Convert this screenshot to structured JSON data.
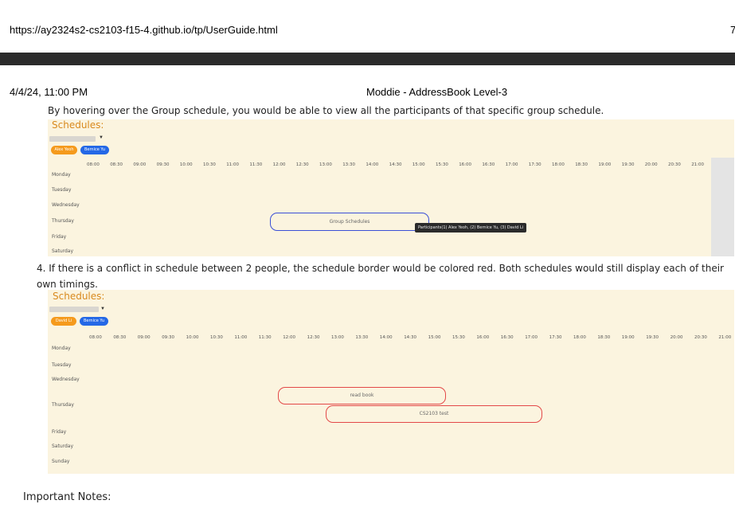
{
  "browser": {
    "url": "https://ay2324s2-cs2103-f15-4.github.io/tp/UserGuide.html",
    "edge_fragment": "7"
  },
  "print_header": {
    "datetime": "4/4/24, 11:00 PM",
    "doc_title": "Moddie - AddressBook Level-3"
  },
  "content": {
    "hover_paragraph": "By hovering over the Group schedule, you would be able to view all the participants of that specific group schedule.",
    "item4_text": "4. If there is a conflict in schedule between 2 people, the schedule border would be colored red. Both schedules would still display each of their own timings.",
    "important_notes": "Important Notes:"
  },
  "panel1": {
    "title": "Schedules:",
    "chips": [
      "Alex Yeoh",
      "Bernice Yu"
    ],
    "times": [
      "08:00",
      "08:30",
      "09:00",
      "09:30",
      "10:00",
      "10:30",
      "11:00",
      "11:30",
      "12:00",
      "12:30",
      "13:00",
      "13:30",
      "14:00",
      "14:30",
      "15:00",
      "15:30",
      "16:00",
      "16:30",
      "17:00",
      "17:30",
      "18:00",
      "18:30",
      "19:00",
      "19:30",
      "20:00",
      "20:30",
      "21:00"
    ],
    "days": [
      "Monday",
      "Tuesday",
      "Wednesday",
      "Thursday",
      "Friday",
      "Saturday"
    ],
    "block_label": "Group Schedules",
    "tooltip": "Participants(1) Alex Yeoh, (2) Bernice Yu, (3) David Li"
  },
  "panel2": {
    "title": "Schedules:",
    "chips": [
      "David Li",
      "Bernice Yu"
    ],
    "times": [
      "08:00",
      "08:30",
      "09:00",
      "09:30",
      "10:00",
      "10:30",
      "11:00",
      "11:30",
      "12:00",
      "12:30",
      "13:00",
      "13:30",
      "14:00",
      "14:30",
      "15:00",
      "15:30",
      "16:00",
      "16:30",
      "17:00",
      "17:30",
      "18:00",
      "18:30",
      "19:00",
      "19:30",
      "20:00",
      "20:30",
      "21:00"
    ],
    "days": [
      "Monday",
      "Tuesday",
      "Wednesday",
      "Thursday",
      "Friday",
      "Saturday",
      "Sunday"
    ],
    "block1_label": "read book",
    "block2_label": "CS2103 test"
  },
  "colors": {
    "panel_bg": "#fbf4df",
    "title_orange": "#d98a1e",
    "chip_orange": "#f59a1c",
    "chip_blue": "#2468e6",
    "group_border": "#3a4fd6",
    "conflict_border": "#e34848"
  }
}
